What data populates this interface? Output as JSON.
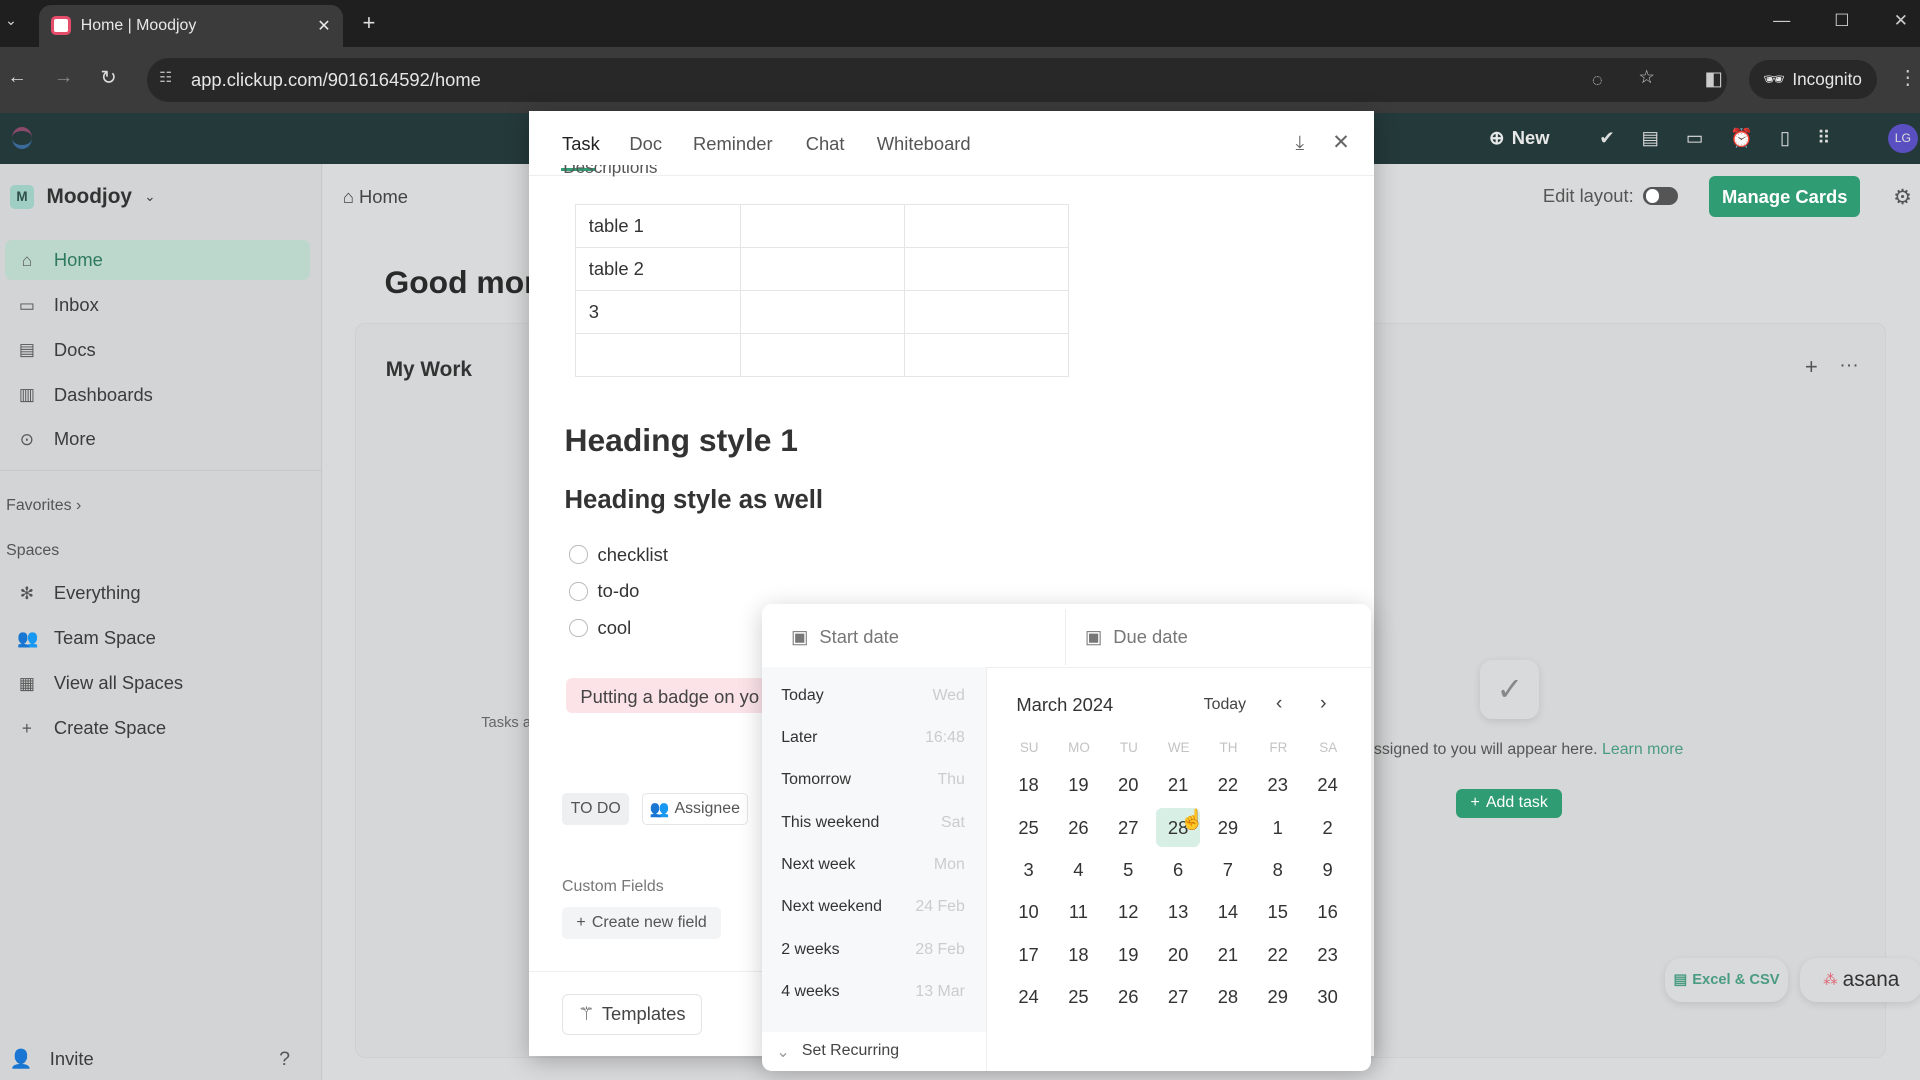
{
  "browser": {
    "tab_title": "Home | Moodjoy",
    "url": "app.clickup.com/9016164592/home",
    "incognito_label": "Incognito"
  },
  "appbar": {
    "new_label": "New",
    "avatar_initials": "LG"
  },
  "sidebar": {
    "workspace_initial": "M",
    "workspace_name": "Moodjoy",
    "items": [
      {
        "label": "Home",
        "icon": "home-icon",
        "glyph": "⌂"
      },
      {
        "label": "Inbox",
        "icon": "inbox-icon",
        "glyph": "▭"
      },
      {
        "label": "Docs",
        "icon": "doc-icon",
        "glyph": "▤"
      },
      {
        "label": "Dashboards",
        "icon": "dashboard-icon",
        "glyph": "▥"
      },
      {
        "label": "More",
        "icon": "more-icon",
        "glyph": "⊙"
      }
    ],
    "favorites_label": "Favorites",
    "spaces_label": "Spaces",
    "spaces": [
      {
        "label": "Everything",
        "icon": "everything-icon",
        "glyph": "✻"
      },
      {
        "label": "Team Space",
        "icon": "team-icon",
        "glyph": "👥"
      },
      {
        "label": "View all Spaces",
        "icon": "grid-icon",
        "glyph": "▦"
      },
      {
        "label": "Create Space",
        "icon": "plus-icon",
        "glyph": "+"
      }
    ],
    "invite_label": "Invite"
  },
  "main": {
    "breadcrumb": "Home",
    "greeting": "Good mor",
    "edit_layout_label": "Edit layout:",
    "manage_cards_label": "Manage Cards",
    "my_work_title": "My Work",
    "tasks_partial": "Tasks a",
    "empty_text": "ssigned to you will appear here.",
    "learn_more": "Learn more",
    "add_task_label": "Add task",
    "import_excel": "Excel & CSV",
    "import_asana": "asana"
  },
  "modal": {
    "tabs": [
      "Task",
      "Doc",
      "Reminder",
      "Chat",
      "Whiteboard"
    ],
    "active_tab": "Task",
    "descriptions_label": "Descriptions",
    "table": [
      [
        "table 1",
        "",
        ""
      ],
      [
        "table 2",
        "",
        ""
      ],
      [
        "3",
        "",
        ""
      ],
      [
        "",
        "",
        ""
      ]
    ],
    "heading1": "Heading style 1",
    "heading2": "Heading style as well",
    "checklist": [
      "checklist",
      "to-do",
      "cool"
    ],
    "badge_text": "Putting a badge on yo",
    "status": "TO DO",
    "assignee_label": "Assignee",
    "custom_fields_label": "Custom Fields",
    "create_field_label": "Create new field",
    "templates_label": "Templates"
  },
  "datepicker": {
    "start_placeholder": "Start date",
    "due_placeholder": "Due date",
    "quick": [
      {
        "label": "Today",
        "hint": "Wed"
      },
      {
        "label": "Later",
        "hint": "16:48"
      },
      {
        "label": "Tomorrow",
        "hint": "Thu"
      },
      {
        "label": "This weekend",
        "hint": "Sat"
      },
      {
        "label": "Next week",
        "hint": "Mon"
      },
      {
        "label": "Next weekend",
        "hint": "24 Feb"
      },
      {
        "label": "2 weeks",
        "hint": "28 Feb"
      },
      {
        "label": "4 weeks",
        "hint": "13 Mar"
      }
    ],
    "set_recurring": "Set Recurring",
    "month_label": "March 2024",
    "today_label": "Today",
    "weekdays": [
      "SU",
      "MO",
      "TU",
      "WE",
      "TH",
      "FR",
      "SA"
    ],
    "weeks": [
      [
        18,
        19,
        20,
        21,
        22,
        23,
        24
      ],
      [
        25,
        26,
        27,
        28,
        29,
        1,
        2
      ],
      [
        3,
        4,
        5,
        6,
        7,
        8,
        9
      ],
      [
        10,
        11,
        12,
        13,
        14,
        15,
        16
      ],
      [
        17,
        18,
        19,
        20,
        21,
        22,
        23
      ],
      [
        24,
        25,
        26,
        27,
        28,
        29,
        30
      ]
    ],
    "highlighted": {
      "week": 1,
      "day": 3
    },
    "highlight_color": "#d8efe6"
  },
  "colors": {
    "accent": "#2f9c73",
    "appbar": "#24393a"
  }
}
